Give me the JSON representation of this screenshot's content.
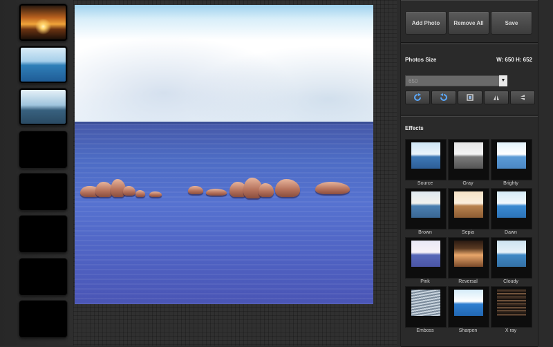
{
  "toolbar": {
    "add_photo": "Add Photo",
    "remove_all": "Remove All",
    "save": "Save"
  },
  "size_section": {
    "title": "Photos Size",
    "readout": "W: 650 H: 652",
    "dropdown_value": "650",
    "tools": [
      "rotate-right-icon",
      "rotate-left-icon",
      "crop-icon",
      "flip-vertical-icon",
      "flip-horizontal-icon"
    ]
  },
  "effects": {
    "title": "Effects",
    "items": [
      {
        "label": "Source"
      },
      {
        "label": "Gray"
      },
      {
        "label": "Brighty"
      },
      {
        "label": "Brown"
      },
      {
        "label": "Sepia"
      },
      {
        "label": "Dawn"
      },
      {
        "label": "Pink"
      },
      {
        "label": "Reversal"
      },
      {
        "label": "Cloudy"
      },
      {
        "label": "Emboss"
      },
      {
        "label": "Sharpen"
      },
      {
        "label": "X ray"
      }
    ]
  },
  "filmstrip": {
    "slots": [
      "sunset-photo",
      "sea-photo",
      "coast-photo",
      "empty",
      "empty",
      "empty",
      "empty",
      "empty"
    ]
  }
}
